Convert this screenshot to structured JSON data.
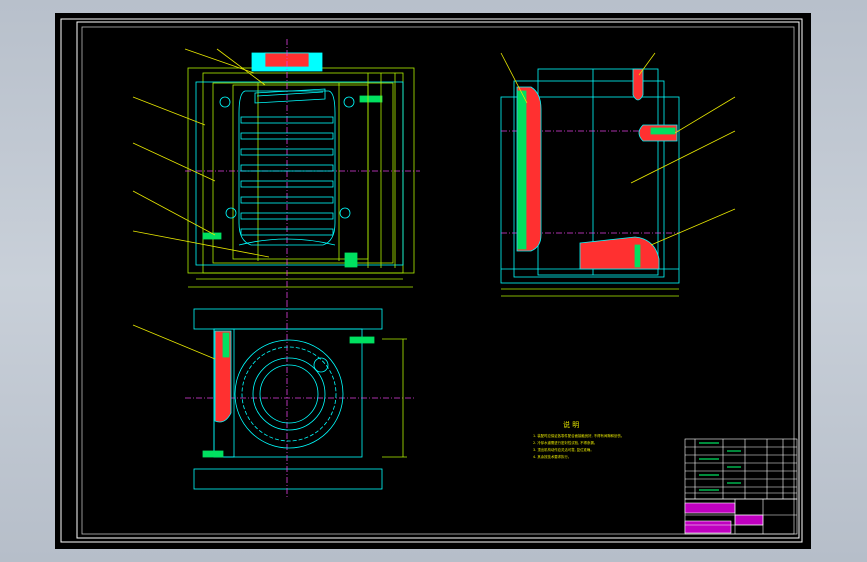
{
  "window": {
    "title": ""
  },
  "notes": {
    "heading": "说 明",
    "lines": [
      "1. 装配时应保证各零件配合面接触良好, 不得有间隙和划伤。",
      "2. 冷却水道需进行密封性试验, 不得渗漏。",
      "3. 顶出机构动作应灵活可靠, 复位准确。",
      "4. 其余按技术要求执行。"
    ]
  },
  "title_block": {
    "drawing_title": ""
  },
  "colors": {
    "background": "#000000",
    "frame": "#ffffff",
    "outline": "#00ffff",
    "mold_plate": "#b0f000",
    "leader": "#e6e600",
    "hatch": "#ff3030",
    "fastener": "#00e060",
    "centerline": "#e040e0",
    "titleblock_fill": "#c000c0"
  },
  "icons": {
    "mold_assembly": "mold-assembly-drawing-icon",
    "cavity": "bottle-cavity-icon"
  }
}
